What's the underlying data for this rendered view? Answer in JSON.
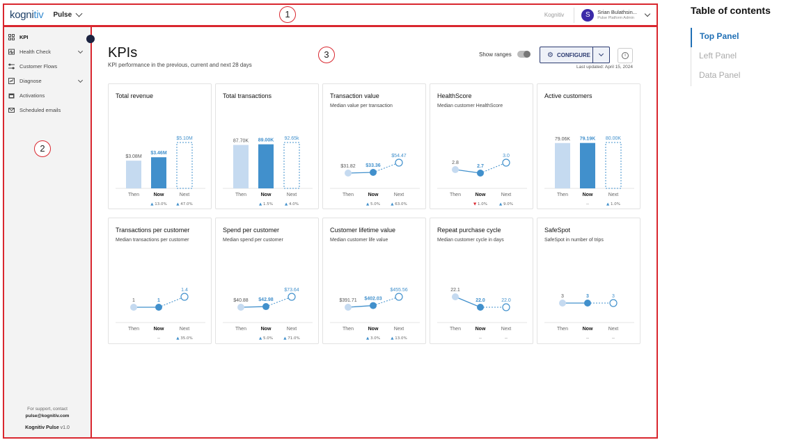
{
  "annotations": {
    "top": "1",
    "left": "2",
    "data": "3"
  },
  "topbar": {
    "logo_main": "kogni",
    "logo_accent": "tiv",
    "app_name": "Pulse",
    "brand": "Kognitiv",
    "user_initial": "S",
    "user_name": "Srian Bulathsin...",
    "user_role": "Pulse Platform Admin"
  },
  "sidebar": {
    "items": [
      {
        "label": "KPI",
        "icon": "grid-icon",
        "active": true,
        "expandable": false
      },
      {
        "label": "Health Check",
        "icon": "heart-monitor-icon",
        "active": false,
        "expandable": true
      },
      {
        "label": "Customer Flows",
        "icon": "flow-icon",
        "active": false,
        "expandable": false
      },
      {
        "label": "Diagnose",
        "icon": "chart-icon",
        "active": false,
        "expandable": true
      },
      {
        "label": "Activations",
        "icon": "calendar-icon",
        "active": false,
        "expandable": false
      },
      {
        "label": "Scheduled emails",
        "icon": "mail-icon",
        "active": false,
        "expandable": false
      }
    ],
    "support_text": "For support, contact",
    "support_email": "pulse@kognitiv.com",
    "product": "Kognitiv Pulse",
    "version": "v1.0"
  },
  "main": {
    "title": "KPIs",
    "subtitle": "KPI performance in the previous, current and next 28 days",
    "show_ranges_label": "Show ranges",
    "configure_label": "CONFIGURE",
    "info_label": "i",
    "last_updated": "Last updated: April 15, 2024"
  },
  "toc": {
    "heading": "Table of contents",
    "items": [
      {
        "label": "Top Panel",
        "active": true
      },
      {
        "label": "Left Panel",
        "active": false
      },
      {
        "label": "Data Panel",
        "active": false
      }
    ]
  },
  "colors": {
    "then": "#c5daf0",
    "now": "#4190cc",
    "up": "#4190cc",
    "down": "#d9262e",
    "frame": "#d9262e"
  },
  "chart_labels": {
    "then": "Then",
    "now": "Now",
    "next": "Next"
  },
  "chart_data": [
    {
      "type": "bar",
      "title": "Total revenue",
      "subtitle": "",
      "categories": [
        "Then",
        "Now",
        "Next"
      ],
      "values": [
        3.08,
        3.46,
        5.1
      ],
      "labels": [
        "$3.08M",
        "$3.46M",
        "$5.10M"
      ],
      "deltas": [
        "",
        "▲ 13.0%",
        "▲ 47.0%"
      ],
      "delta_dirs": [
        "",
        "up",
        "up"
      ]
    },
    {
      "type": "bar",
      "title": "Total transactions",
      "subtitle": "",
      "categories": [
        "Then",
        "Now",
        "Next"
      ],
      "values": [
        87.7,
        89.0,
        92.65
      ],
      "labels": [
        "87.70K",
        "89.00K",
        "92.65k"
      ],
      "deltas": [
        "",
        "▲ 1.5%",
        "▲ 4.0%"
      ],
      "delta_dirs": [
        "",
        "up",
        "up"
      ]
    },
    {
      "type": "line",
      "title": "Transaction value",
      "subtitle": "Median value per transaction",
      "categories": [
        "Then",
        "Now",
        "Next"
      ],
      "values": [
        31.82,
        33.36,
        54.47
      ],
      "labels": [
        "$31.82",
        "$33.36",
        "$54.47"
      ],
      "deltas": [
        "",
        "▲ 5.0%",
        "▲ 63.0%"
      ],
      "delta_dirs": [
        "",
        "up",
        "up"
      ]
    },
    {
      "type": "line",
      "title": "HealthScore",
      "subtitle": "Median customer HealthScore",
      "categories": [
        "Then",
        "Now",
        "Next"
      ],
      "values": [
        2.8,
        2.7,
        3.0
      ],
      "labels": [
        "2.8",
        "2.7",
        "3.0"
      ],
      "deltas": [
        "",
        "▼ 1.0%",
        "▲ 9.0%"
      ],
      "delta_dirs": [
        "",
        "down",
        "up"
      ]
    },
    {
      "type": "bar",
      "title": "Active customers",
      "subtitle": "",
      "categories": [
        "Then",
        "Now",
        "Next"
      ],
      "values": [
        79.06,
        79.19,
        80.0
      ],
      "labels": [
        "79.06K",
        "79.19K",
        "80.00K"
      ],
      "deltas": [
        "",
        "--",
        "▲ 1.0%"
      ],
      "delta_dirs": [
        "",
        "none",
        "up"
      ]
    },
    {
      "type": "line",
      "title": "Transactions per customer",
      "subtitle": "Median transactions per customer",
      "categories": [
        "Then",
        "Now",
        "Next"
      ],
      "values": [
        1,
        1,
        1.4
      ],
      "labels": [
        "1",
        "1",
        "1.4"
      ],
      "deltas": [
        "",
        "--",
        "▲ 35.0%"
      ],
      "delta_dirs": [
        "",
        "none",
        "up"
      ]
    },
    {
      "type": "line",
      "title": "Spend per customer",
      "subtitle": "Median spend per customer",
      "categories": [
        "Then",
        "Now",
        "Next"
      ],
      "values": [
        40.88,
        42.98,
        73.64
      ],
      "labels": [
        "$40.88",
        "$42.98",
        "$73.64"
      ],
      "deltas": [
        "",
        "▲ 5.0%",
        "▲ 71.0%"
      ],
      "delta_dirs": [
        "",
        "up",
        "up"
      ]
    },
    {
      "type": "line",
      "title": "Customer lifetime value",
      "subtitle": "Median customer life value",
      "categories": [
        "Then",
        "Now",
        "Next"
      ],
      "values": [
        391.71,
        402.03,
        455.56
      ],
      "labels": [
        "$391.71",
        "$402.03",
        "$455.56"
      ],
      "deltas": [
        "",
        "▲ 3.0%",
        "▲ 13.0%"
      ],
      "delta_dirs": [
        "",
        "up",
        "up"
      ]
    },
    {
      "type": "line",
      "title": "Repeat purchase cycle",
      "subtitle": "Median customer cycle in days",
      "categories": [
        "Then",
        "Now",
        "Next"
      ],
      "values": [
        22.1,
        22.0,
        22.0
      ],
      "labels": [
        "22.1",
        "22.0",
        "22.0"
      ],
      "deltas": [
        "",
        "--",
        "--"
      ],
      "delta_dirs": [
        "",
        "none",
        "none"
      ]
    },
    {
      "type": "line",
      "title": "SafeSpot",
      "subtitle": "SafeSpot in number of trips",
      "categories": [
        "Then",
        "Now",
        "Next"
      ],
      "values": [
        3,
        3,
        3
      ],
      "labels": [
        "3",
        "3",
        "3"
      ],
      "deltas": [
        "",
        "--",
        "--"
      ],
      "delta_dirs": [
        "",
        "none",
        "none"
      ]
    }
  ]
}
